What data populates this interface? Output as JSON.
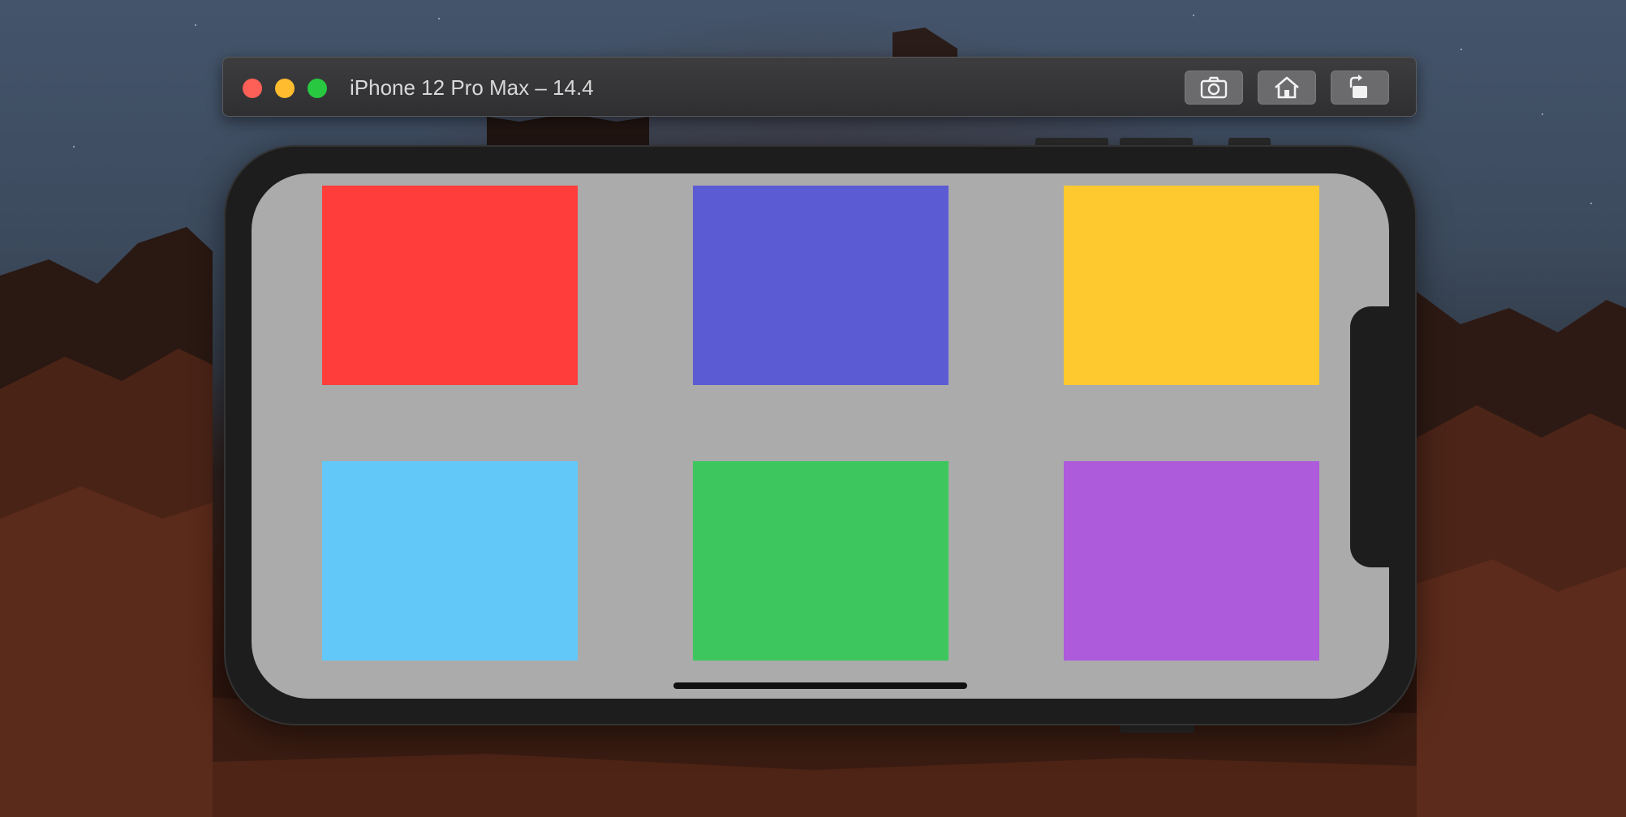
{
  "window": {
    "title": "iPhone 12 Pro Max – 14.4",
    "controls": [
      "close",
      "minimize",
      "zoom"
    ],
    "toolbar": [
      {
        "name": "screenshot-button",
        "icon": "camera-icon"
      },
      {
        "name": "home-button",
        "icon": "home-icon"
      },
      {
        "name": "rotate-button",
        "icon": "rotate-icon"
      }
    ]
  },
  "screen": {
    "background": "#ababab",
    "tiles": [
      {
        "name": "red-tile",
        "color": "#ff3d3a"
      },
      {
        "name": "indigo-tile",
        "color": "#5b5bd4"
      },
      {
        "name": "yellow-tile",
        "color": "#fdc92e"
      },
      {
        "name": "light-blue-tile",
        "color": "#62c8f8"
      },
      {
        "name": "green-tile",
        "color": "#3dc65d"
      },
      {
        "name": "purple-tile",
        "color": "#ad5bda"
      }
    ]
  },
  "colors": {
    "traffic_close": "#fe5f57",
    "traffic_minimize": "#febc2e",
    "traffic_zoom": "#28c840",
    "device_frame": "#1d1d1d"
  }
}
